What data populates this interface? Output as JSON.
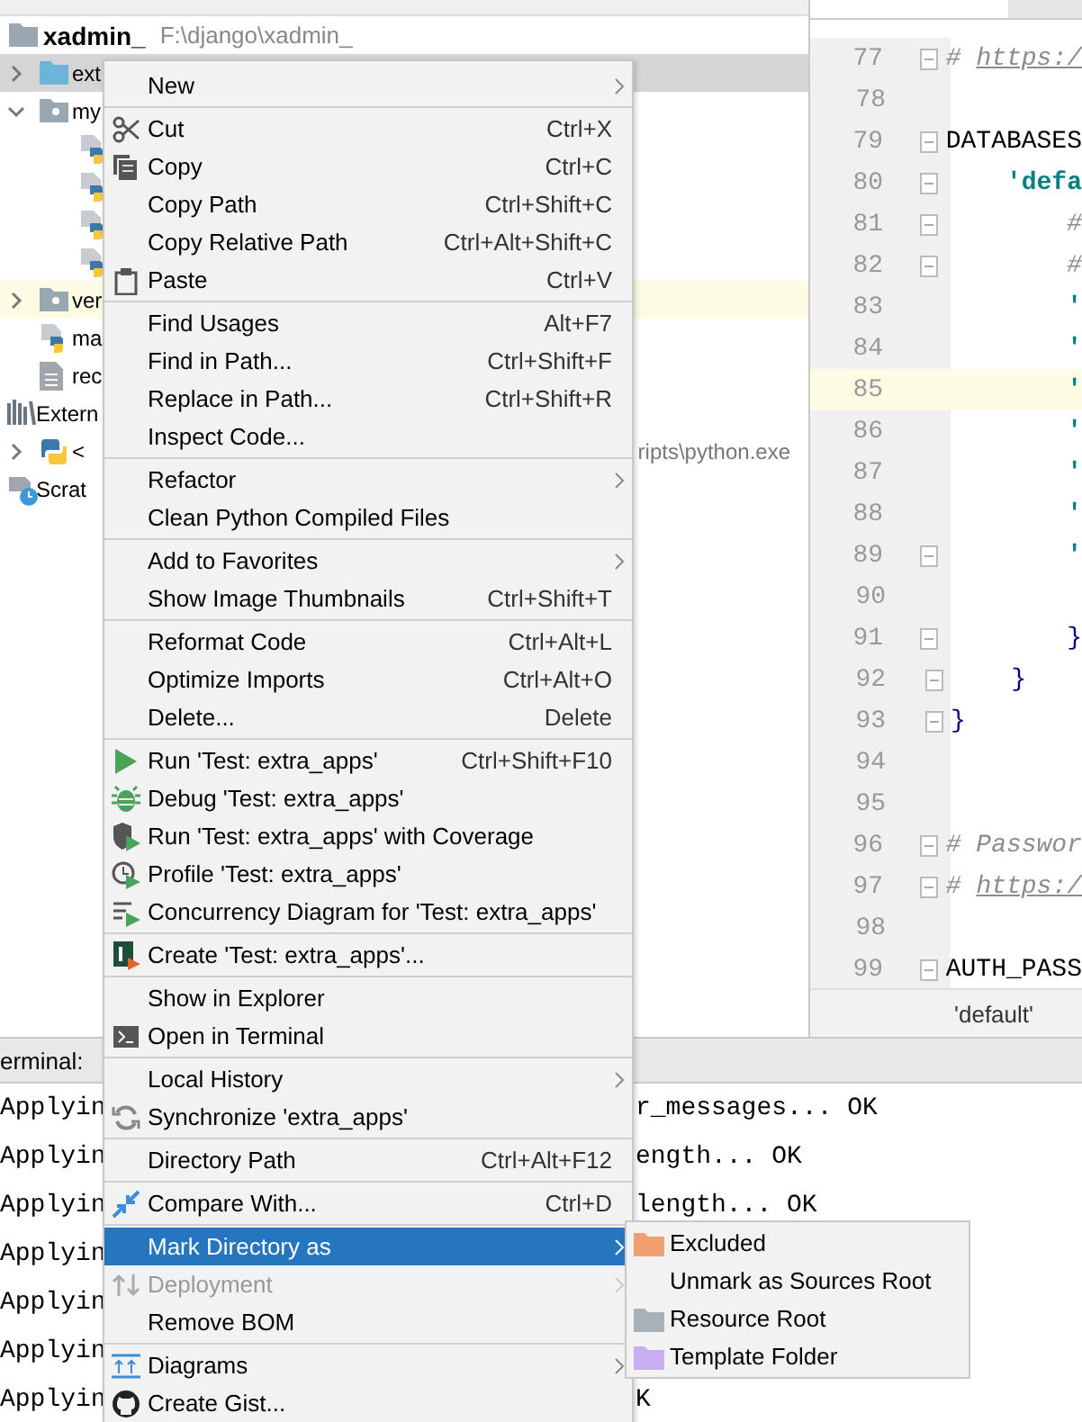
{
  "project_tree": {
    "root": {
      "label": "xadmin_",
      "path": "F:\\django\\xadmin_"
    },
    "items": [
      {
        "kind": "source-folder",
        "label": "ext",
        "expanded": false,
        "selected": true,
        "highlighted": false
      },
      {
        "kind": "folder",
        "label": "my",
        "expanded": true,
        "selected": false,
        "highlighted": false,
        "children": [
          {
            "kind": "python",
            "selected": false,
            "highlighted": false
          },
          {
            "kind": "python",
            "selected": false,
            "highlighted": false
          },
          {
            "kind": "python",
            "selected": false,
            "highlighted": false
          },
          {
            "kind": "python",
            "selected": false,
            "highlighted": false
          }
        ]
      },
      {
        "kind": "folder",
        "label": "ver",
        "expanded": false,
        "selected": false,
        "highlighted": true
      },
      {
        "kind": "python",
        "label": "ma",
        "selected": false,
        "highlighted": false
      },
      {
        "kind": "text",
        "label": "rec",
        "selected": false,
        "highlighted": false
      }
    ],
    "top_items": [
      {
        "kind": "library",
        "label": "Extern",
        "selected": false
      },
      {
        "kind": "python-sdk",
        "label": "<",
        "detail": "ripts\\python.exe",
        "expanded": false,
        "selected": false
      },
      {
        "kind": "scratch",
        "label": "Scrat",
        "selected": false
      }
    ]
  },
  "editor": {
    "lines": [
      {
        "number": "77",
        "fold": true,
        "current": false,
        "segments": [
          {
            "text": "# ",
            "kind": "comment"
          },
          {
            "text": "https:/",
            "kind": "link"
          }
        ]
      },
      {
        "number": "78",
        "fold": false,
        "current": false
      },
      {
        "number": "79",
        "fold": true,
        "current": false,
        "segments": [
          {
            "text": "DATABASES",
            "kind": "plain"
          }
        ]
      },
      {
        "number": "80",
        "fold": true,
        "current": false,
        "segments": [
          {
            "text": "    'defa",
            "kind": "key"
          }
        ]
      },
      {
        "number": "81",
        "fold": true,
        "current": false,
        "segments": [
          {
            "text": "        #",
            "kind": "comment"
          }
        ]
      },
      {
        "number": "82",
        "fold": true,
        "current": false,
        "segments": [
          {
            "text": "        #",
            "kind": "comment"
          }
        ]
      },
      {
        "number": "83",
        "fold": false,
        "current": false,
        "segments": [
          {
            "text": "        '",
            "kind": "key"
          }
        ]
      },
      {
        "number": "84",
        "fold": false,
        "current": false,
        "segments": [
          {
            "text": "        '",
            "kind": "key"
          }
        ]
      },
      {
        "number": "85",
        "fold": false,
        "current": true,
        "segments": [
          {
            "text": "        '",
            "kind": "key"
          }
        ]
      },
      {
        "number": "86",
        "fold": false,
        "current": false,
        "segments": [
          {
            "text": "        '",
            "kind": "key"
          }
        ]
      },
      {
        "number": "87",
        "fold": false,
        "current": false,
        "segments": [
          {
            "text": "        '",
            "kind": "key"
          }
        ]
      },
      {
        "number": "88",
        "fold": false,
        "current": false,
        "segments": [
          {
            "text": "        '",
            "kind": "key"
          }
        ]
      },
      {
        "number": "89",
        "fold": true,
        "current": false,
        "segments": [
          {
            "text": "        '",
            "kind": "key"
          }
        ]
      },
      {
        "number": "90",
        "fold": false,
        "current": false
      },
      {
        "number": "91",
        "fold": true,
        "current": false,
        "segments": [
          {
            "text": "        }",
            "kind": "brace"
          }
        ]
      },
      {
        "number": "92",
        "fold": true,
        "current": false,
        "segments": [
          {
            "text": "    }",
            "kind": "brace"
          }
        ]
      },
      {
        "number": "93",
        "fold": true,
        "current": false,
        "segments": [
          {
            "text": "}",
            "kind": "brace"
          }
        ]
      },
      {
        "number": "94",
        "fold": false,
        "current": false
      },
      {
        "number": "95",
        "fold": false,
        "current": false
      },
      {
        "number": "96",
        "fold": true,
        "current": false,
        "segments": [
          {
            "text": "# Passwor",
            "kind": "comment"
          }
        ]
      },
      {
        "number": "97",
        "fold": true,
        "current": false,
        "segments": [
          {
            "text": "# ",
            "kind": "comment"
          },
          {
            "text": "https:/",
            "kind": "link"
          }
        ]
      },
      {
        "number": "98",
        "fold": false,
        "current": false
      },
      {
        "number": "99",
        "fold": true,
        "current": false,
        "segments": [
          {
            "text": "AUTH_PASS",
            "kind": "plain"
          }
        ]
      }
    ],
    "breadcrumb": "'default'"
  },
  "terminal": {
    "title": "erminal:",
    "lines": [
      {
        "left": "Applyin",
        "right": "r_messages... OK"
      },
      {
        "left": "Applyin",
        "right": "ength... OK"
      },
      {
        "left": "Applyin",
        "right": "length... OK"
      },
      {
        "left": "Applyin"
      },
      {
        "left": "Applyin"
      },
      {
        "left": "Applyin"
      },
      {
        "left": "Applyin",
        "right": "K"
      }
    ]
  },
  "context_menu": {
    "items": [
      {
        "kind": "item",
        "label": "New",
        "submenu": true,
        "disabled": false,
        "selected": false
      },
      {
        "kind": "separator"
      },
      {
        "kind": "item",
        "label": "Cut",
        "shortcut": "Ctrl+X",
        "disabled": false,
        "selected": false
      },
      {
        "kind": "item",
        "label": "Copy",
        "shortcut": "Ctrl+C",
        "disabled": false,
        "selected": false
      },
      {
        "kind": "item",
        "label": "Copy Path",
        "shortcut": "Ctrl+Shift+C",
        "disabled": false,
        "selected": false
      },
      {
        "kind": "item",
        "label": "Copy Relative Path",
        "shortcut": "Ctrl+Alt+Shift+C",
        "disabled": false,
        "selected": false
      },
      {
        "kind": "item",
        "label": "Paste",
        "shortcut": "Ctrl+V",
        "disabled": false,
        "selected": false
      },
      {
        "kind": "separator"
      },
      {
        "kind": "item",
        "label": "Find Usages",
        "shortcut": "Alt+F7",
        "disabled": false,
        "selected": false
      },
      {
        "kind": "item",
        "label": "Find in Path...",
        "shortcut": "Ctrl+Shift+F",
        "disabled": false,
        "selected": false
      },
      {
        "kind": "item",
        "label": "Replace in Path...",
        "shortcut": "Ctrl+Shift+R",
        "disabled": false,
        "selected": false
      },
      {
        "kind": "item",
        "label": "Inspect Code...",
        "disabled": false,
        "selected": false
      },
      {
        "kind": "separator"
      },
      {
        "kind": "item",
        "label": "Refactor",
        "submenu": true,
        "disabled": false,
        "selected": false
      },
      {
        "kind": "item",
        "label": "Clean Python Compiled Files",
        "disabled": false,
        "selected": false
      },
      {
        "kind": "separator"
      },
      {
        "kind": "item",
        "label": "Add to Favorites",
        "submenu": true,
        "disabled": false,
        "selected": false
      },
      {
        "kind": "item",
        "label": "Show Image Thumbnails",
        "shortcut": "Ctrl+Shift+T",
        "disabled": false,
        "selected": false
      },
      {
        "kind": "separator"
      },
      {
        "kind": "item",
        "label": "Reformat Code",
        "shortcut": "Ctrl+Alt+L",
        "disabled": false,
        "selected": false
      },
      {
        "kind": "item",
        "label": "Optimize Imports",
        "shortcut": "Ctrl+Alt+O",
        "disabled": false,
        "selected": false
      },
      {
        "kind": "item",
        "label": "Delete...",
        "shortcut": "Delete",
        "disabled": false,
        "selected": false
      },
      {
        "kind": "separator"
      },
      {
        "kind": "item",
        "label": "Run 'Test: extra_apps'",
        "shortcut": "Ctrl+Shift+F10",
        "disabled": false,
        "selected": false
      },
      {
        "kind": "item",
        "label": "Debug 'Test: extra_apps'",
        "disabled": false,
        "selected": false
      },
      {
        "kind": "item",
        "label": "Run 'Test: extra_apps' with Coverage",
        "disabled": false,
        "selected": false
      },
      {
        "kind": "item",
        "label": "Profile 'Test: extra_apps'",
        "disabled": false,
        "selected": false
      },
      {
        "kind": "item",
        "label": "Concurrency Diagram for 'Test: extra_apps'",
        "disabled": false,
        "selected": false
      },
      {
        "kind": "separator"
      },
      {
        "kind": "item",
        "label": "Create 'Test: extra_apps'...",
        "disabled": false,
        "selected": false
      },
      {
        "kind": "separator"
      },
      {
        "kind": "item",
        "label": "Show in Explorer",
        "disabled": false,
        "selected": false
      },
      {
        "kind": "item",
        "label": "Open in Terminal",
        "disabled": false,
        "selected": false
      },
      {
        "kind": "separator"
      },
      {
        "kind": "item",
        "label": "Local History",
        "submenu": true,
        "disabled": false,
        "selected": false
      },
      {
        "kind": "item",
        "label": "Synchronize 'extra_apps'",
        "disabled": false,
        "selected": false
      },
      {
        "kind": "separator"
      },
      {
        "kind": "item",
        "label": "Directory Path",
        "shortcut": "Ctrl+Alt+F12",
        "disabled": false,
        "selected": false
      },
      {
        "kind": "separator"
      },
      {
        "kind": "item",
        "label": "Compare With...",
        "shortcut": "Ctrl+D",
        "disabled": false,
        "selected": false
      },
      {
        "kind": "separator"
      },
      {
        "kind": "item",
        "label": "Mark Directory as",
        "submenu": true,
        "disabled": false,
        "selected": true
      },
      {
        "kind": "item",
        "label": "Deployment",
        "submenu": true,
        "disabled": true,
        "selected": false
      },
      {
        "kind": "item",
        "label": "Remove BOM",
        "disabled": false,
        "selected": false
      },
      {
        "kind": "separator"
      },
      {
        "kind": "item",
        "label": "Diagrams",
        "submenu": true,
        "disabled": false,
        "selected": false
      },
      {
        "kind": "item",
        "label": "Create Gist...",
        "disabled": false,
        "selected": false
      }
    ]
  },
  "submenu": {
    "items": [
      {
        "label": "Excluded",
        "color": "#f0a070",
        "selected": false
      },
      {
        "label": "Unmark as Sources Root",
        "selected": false
      },
      {
        "label": "Resource Root",
        "color": "#a8b0b8",
        "selected": false
      },
      {
        "label": "Template Folder",
        "color": "#c8aef0",
        "selected": false
      }
    ]
  }
}
